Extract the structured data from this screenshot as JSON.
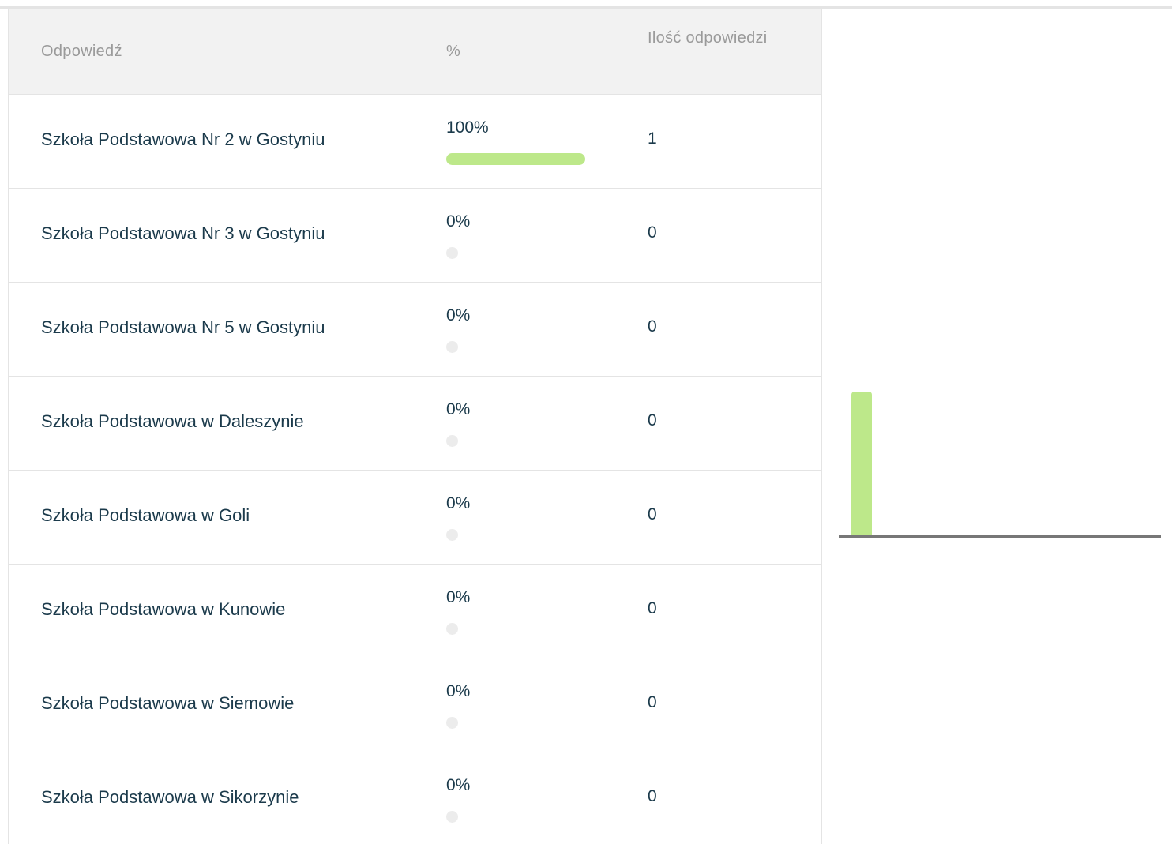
{
  "table": {
    "headers": {
      "answer": "Odpowiedź",
      "percent": "%",
      "count": "Ilość odpowiedzi"
    },
    "rows": [
      {
        "answer": "Szkoła Podstawowa Nr 2 w Gostyniu",
        "percent_label": "100%",
        "percent": 100,
        "count": "1"
      },
      {
        "answer": "Szkoła Podstawowa Nr 3 w Gostyniu",
        "percent_label": "0%",
        "percent": 0,
        "count": "0"
      },
      {
        "answer": "Szkoła Podstawowa Nr 5 w Gostyniu",
        "percent_label": "0%",
        "percent": 0,
        "count": "0"
      },
      {
        "answer": "Szkoła Podstawowa w Daleszynie",
        "percent_label": "0%",
        "percent": 0,
        "count": "0"
      },
      {
        "answer": "Szkoła Podstawowa w Goli",
        "percent_label": "0%",
        "percent": 0,
        "count": "0"
      },
      {
        "answer": "Szkoła Podstawowa w Kunowie",
        "percent_label": "0%",
        "percent": 0,
        "count": "0"
      },
      {
        "answer": "Szkoła Podstawowa w Siemowie",
        "percent_label": "0%",
        "percent": 0,
        "count": "0"
      },
      {
        "answer": "Szkoła Podstawowa w Sikorzynie",
        "percent_label": "0%",
        "percent": 0,
        "count": "0"
      }
    ]
  },
  "colors": {
    "bar": "#bde88a",
    "bar_empty": "#ececec",
    "axis": "#777777",
    "text": "#1b3a4b",
    "header_text": "#9a9a9a"
  },
  "chart_data": {
    "type": "bar",
    "categories": [
      "Szkoła Podstawowa Nr 2 w Gostyniu",
      "Szkoła Podstawowa Nr 3 w Gostyniu",
      "Szkoła Podstawowa Nr 5 w Gostyniu",
      "Szkoła Podstawowa w Daleszynie",
      "Szkoła Podstawowa w Goli",
      "Szkoła Podstawowa w Kunowie",
      "Szkoła Podstawowa w Siemowie",
      "Szkoła Podstawowa w Sikorzynie"
    ],
    "values": [
      1,
      0,
      0,
      0,
      0,
      0,
      0,
      0
    ],
    "ylim": [
      0,
      1
    ]
  }
}
